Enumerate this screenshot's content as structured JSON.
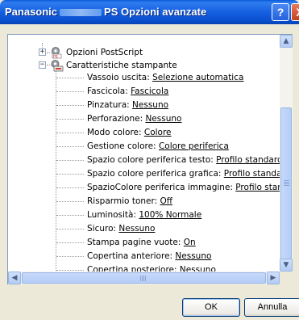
{
  "window": {
    "title_prefix": "Panasonic",
    "title_suffix": "PS Opzioni avanzate",
    "help_label": "?",
    "close_label": "X"
  },
  "tree": {
    "postscript_label": "Opzioni PostScript",
    "features_label": "Caratteristiche stampante",
    "features": [
      {
        "label": "Vassoio uscita: ",
        "value": "Selezione automatica"
      },
      {
        "label": "Fascicola: ",
        "value": "Fascicola"
      },
      {
        "label": "Pinzatura: ",
        "value": "Nessuno"
      },
      {
        "label": "Perforazione: ",
        "value": "Nessuno"
      },
      {
        "label": "Modo colore: ",
        "value": "Colore"
      },
      {
        "label": "Gestione colore: ",
        "value": "Colore periferica"
      },
      {
        "label": "Spazio colore periferica testo: ",
        "value": "Profilo standard con nero-"
      },
      {
        "label": "Spazio colore periferica grafica: ",
        "value": "Profilo standard con ner"
      },
      {
        "label": "SpazioColore periferica immagine: ",
        "value": "Profilo standard con C"
      },
      {
        "label": "Risparmio toner: ",
        "value": "Off"
      },
      {
        "label": "Luminosità: ",
        "value": "100% Normale"
      },
      {
        "label": "Sicuro: ",
        "value": "Nessuno"
      },
      {
        "label": "Stampa pagine vuote: ",
        "value": "On"
      },
      {
        "label": "Copertina anteriore: ",
        "value": "Nessuno"
      },
      {
        "label": "Copertina posteriore: ",
        "value": "Nessuno"
      }
    ]
  },
  "buttons": {
    "ok": "OK",
    "cancel": "Annulla"
  },
  "icons": {
    "expand_collapsed": "plus-box-icon",
    "expand_expanded": "minus-box-icon",
    "postscript": "postscript-gear-icon",
    "printer_features": "printer-gear-icon"
  }
}
